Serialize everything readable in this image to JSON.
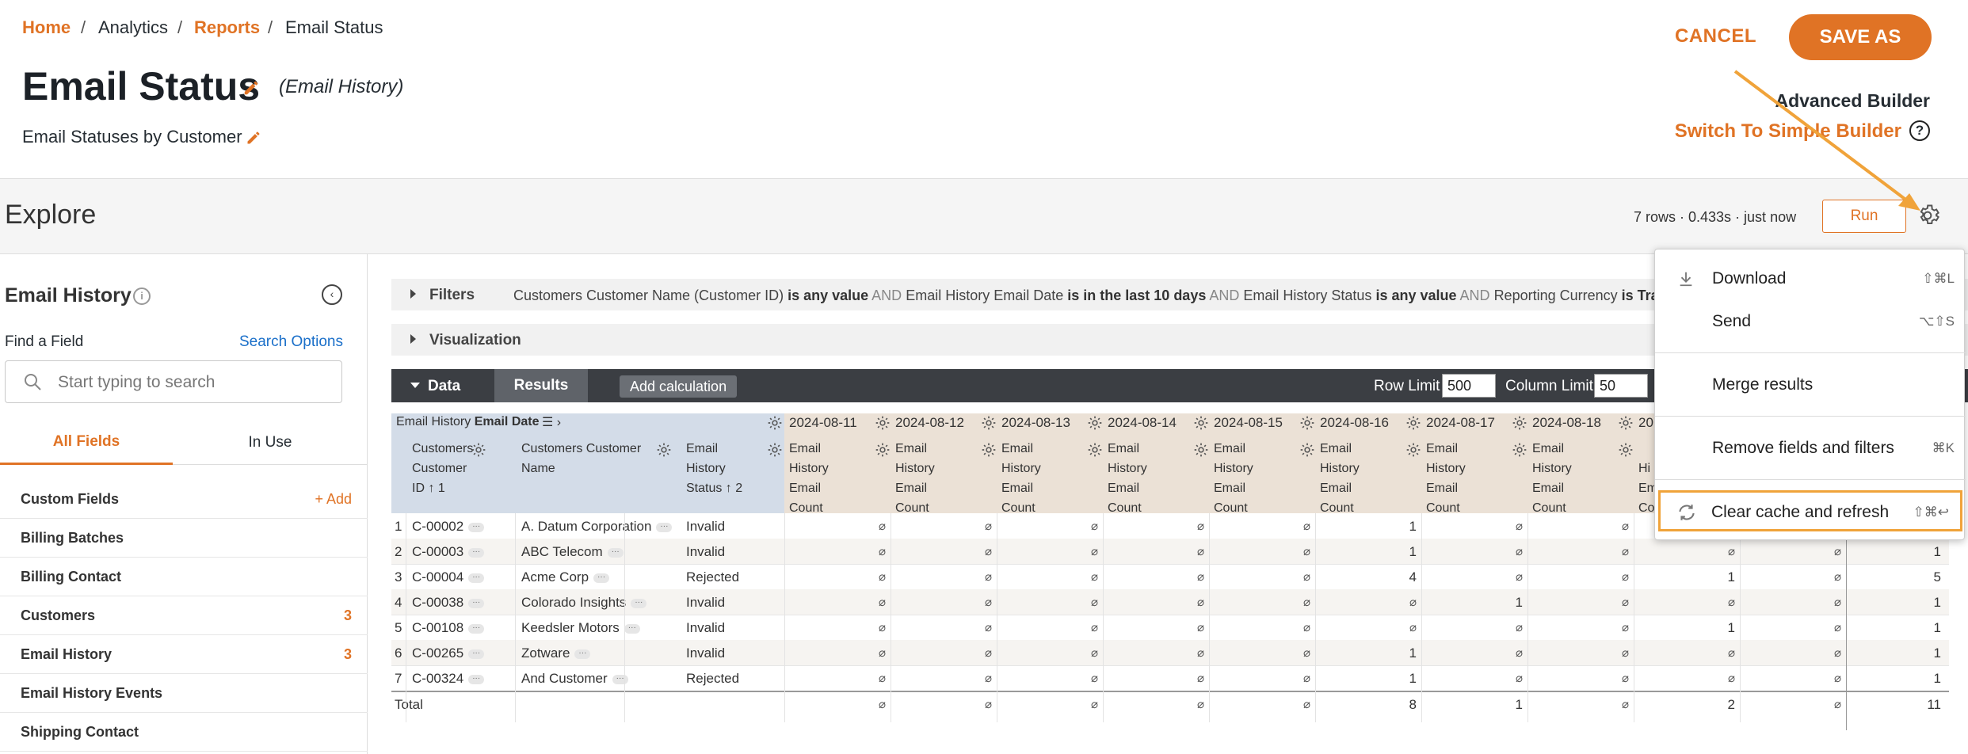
{
  "breadcrumb": {
    "home": "Home",
    "analytics": "Analytics",
    "reports": "Reports",
    "current": "Email Status",
    "sep": "/"
  },
  "title": "Email Status",
  "title_sub": "(Email History)",
  "subtitle": "Email Statuses by Customer",
  "actions": {
    "cancel": "CANCEL",
    "save_as": "SAVE AS",
    "advanced_builder": "Advanced Builder",
    "simple_builder": "Switch To Simple Builder",
    "help": "?"
  },
  "explore": {
    "title": "Explore",
    "run_meta": "7 rows · 0.433s · just now",
    "run": "Run"
  },
  "sidebar": {
    "title": "Email History",
    "find_field": "Find a Field",
    "search_options": "Search Options",
    "search_placeholder": "Start typing to search",
    "tabs": {
      "all": "All Fields",
      "in_use": "In Use"
    },
    "items": [
      {
        "label": "Custom Fields",
        "count": "",
        "add": "+ Add"
      },
      {
        "label": "Billing Batches",
        "count": ""
      },
      {
        "label": "Billing Contact",
        "count": ""
      },
      {
        "label": "Customers",
        "count": "3"
      },
      {
        "label": "Email History",
        "count": "3"
      },
      {
        "label": "Email History Events",
        "count": ""
      },
      {
        "label": "Shipping Contact",
        "count": ""
      }
    ]
  },
  "filters": {
    "label": "Filters",
    "parts": [
      {
        "field": "Customers Customer Name (Customer ID)",
        "cond": "is any value"
      },
      {
        "field": "Email History Email Date",
        "cond": "is in the last 10 days"
      },
      {
        "field": "Email History Status",
        "cond": "is any value"
      },
      {
        "field": "Reporting Currency",
        "cond": "is Transa"
      }
    ],
    "and": "AND"
  },
  "visualization": {
    "label": "Visualization"
  },
  "data_bar": {
    "data": "Data",
    "results": "Results",
    "add_calc": "Add calculation",
    "row_limit_label": "Row Limit",
    "row_limit": "500",
    "col_limit_label": "Column Limit",
    "col_limit": "50"
  },
  "table": {
    "pivot_label_pre": "Email History",
    "pivot_label_bold": "Email Date",
    "dates": [
      "2024-08-11",
      "2024-08-12",
      "2024-08-13",
      "2024-08-14",
      "2024-08-15",
      "2024-08-16",
      "2024-08-17",
      "2024-08-18",
      "20"
    ],
    "dim_headers": {
      "id": [
        "Customers",
        "Customer",
        "ID ↑ 1"
      ],
      "name": [
        "Customers Customer",
        "Name"
      ],
      "status": [
        "Email",
        "History",
        "Status ↑ 2"
      ]
    },
    "measure_header": [
      "Email",
      "History",
      "Email",
      "Count"
    ],
    "measure_header_partial": [
      "Hi",
      "Em",
      "Co"
    ],
    "null_symbol": "⌀",
    "rows": [
      {
        "n": "1",
        "id": "C-00002",
        "name": "A. Datum Corporation",
        "status": "Invalid",
        "vals": [
          "⌀",
          "⌀",
          "⌀",
          "⌀",
          "⌀",
          "1",
          "⌀",
          "⌀",
          "⌀",
          "⌀"
        ],
        "total": "1"
      },
      {
        "n": "2",
        "id": "C-00003",
        "name": "ABC Telecom",
        "status": "Invalid",
        "vals": [
          "⌀",
          "⌀",
          "⌀",
          "⌀",
          "⌀",
          "1",
          "⌀",
          "⌀",
          "⌀",
          "⌀"
        ],
        "total": "1"
      },
      {
        "n": "3",
        "id": "C-00004",
        "name": "Acme Corp",
        "status": "Rejected",
        "vals": [
          "⌀",
          "⌀",
          "⌀",
          "⌀",
          "⌀",
          "4",
          "⌀",
          "⌀",
          "1",
          "⌀"
        ],
        "total": "5"
      },
      {
        "n": "4",
        "id": "C-00038",
        "name": "Colorado Insights",
        "status": "Invalid",
        "vals": [
          "⌀",
          "⌀",
          "⌀",
          "⌀",
          "⌀",
          "⌀",
          "1",
          "⌀",
          "⌀",
          "⌀"
        ],
        "total": "1"
      },
      {
        "n": "5",
        "id": "C-00108",
        "name": "Keedsler Motors",
        "status": "Invalid",
        "vals": [
          "⌀",
          "⌀",
          "⌀",
          "⌀",
          "⌀",
          "⌀",
          "⌀",
          "⌀",
          "1",
          "⌀"
        ],
        "total": "1"
      },
      {
        "n": "6",
        "id": "C-00265",
        "name": "Zotware",
        "status": "Invalid",
        "vals": [
          "⌀",
          "⌀",
          "⌀",
          "⌀",
          "⌀",
          "1",
          "⌀",
          "⌀",
          "⌀",
          "⌀"
        ],
        "total": "1"
      },
      {
        "n": "7",
        "id": "C-00324",
        "name": "And Customer",
        "status": "Rejected",
        "vals": [
          "⌀",
          "⌀",
          "⌀",
          "⌀",
          "⌀",
          "1",
          "⌀",
          "⌀",
          "⌀",
          "⌀"
        ],
        "total": "1"
      }
    ],
    "totals": {
      "label": "Total",
      "vals": [
        "⌀",
        "⌀",
        "⌀",
        "⌀",
        "⌀",
        "8",
        "1",
        "⌀",
        "2",
        "⌀"
      ],
      "total": "11"
    },
    "row_tag": "···"
  },
  "menu": {
    "items": [
      {
        "label": "Download",
        "shortcut": "⇧⌘L",
        "icon": "download-icon"
      },
      {
        "label": "Send",
        "shortcut": "⌥⇧S"
      },
      {
        "label": "Merge results",
        "shortcut": ""
      },
      {
        "label": "Remove fields and filters",
        "shortcut": "⌘K"
      },
      {
        "label": "Clear cache and refresh",
        "shortcut": "⇧⌘↩",
        "icon": "refresh-icon"
      }
    ]
  },
  "colors": {
    "accent": "#e07325",
    "dark_bar": "#3b3e43",
    "header_blue": "#d3dce8",
    "header_tan": "#ebe1d6",
    "highlight": "#f0a33a"
  }
}
